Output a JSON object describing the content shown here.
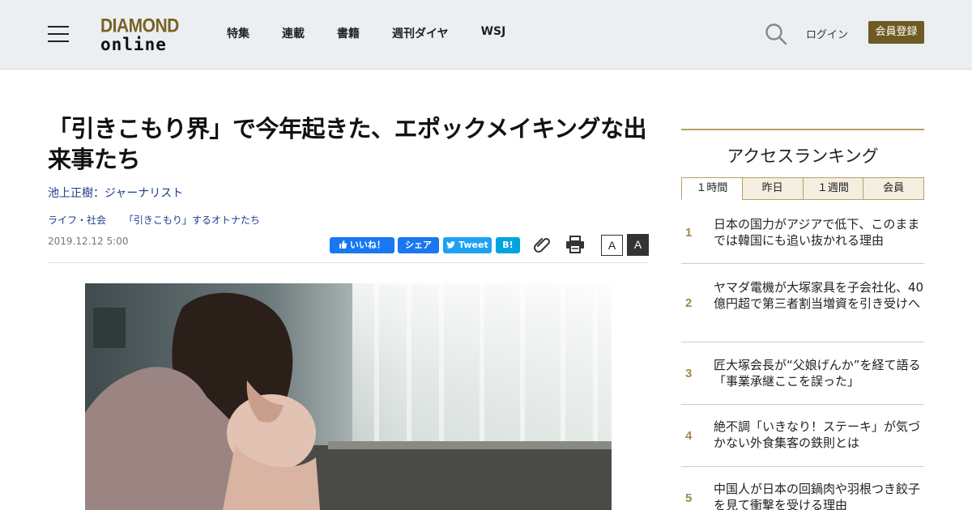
{
  "header": {
    "logo_top": "DIAMOND",
    "logo_bottom": "online",
    "nav": [
      "特集",
      "連載",
      "書籍",
      "週刊ダイヤ",
      "WSJ"
    ],
    "login": "ログイン",
    "register": "会員登録"
  },
  "article": {
    "title": "「引きこもり界」で今年起きた、エポックメイキングな出来事たち",
    "author": "池上正樹：ジャーナリスト",
    "tags": [
      "ライフ・社会",
      "「引きこもり」するオトナたち"
    ],
    "date": "2019.12.12 5:00",
    "share": {
      "like": "いいね！",
      "share": "シェア",
      "tweet": "Tweet",
      "hatena": "B!"
    },
    "font_small": "A",
    "font_large": "A"
  },
  "sidebar": {
    "title": "アクセスランキング",
    "tabs": [
      "１時間",
      "昨日",
      "１週間",
      "会員"
    ],
    "ranking": [
      {
        "rank": "1",
        "text": "日本の国力がアジアで低下、このままでは韓国にも追い抜かれる理由"
      },
      {
        "rank": "2",
        "text": "ヤマダ電機が大塚家具を子会社化、40億円超で第三者割当増資を引き受けへ"
      },
      {
        "rank": "3",
        "text": "匠大塚会長が“父娘げんか”を経て語る「事業承継ここを誤った」"
      },
      {
        "rank": "4",
        "text": "絶不調「いきなり！ステーキ」が気づかない外食集客の鉄則とは"
      },
      {
        "rank": "5",
        "text": "中国人が日本の回鍋肉や羽根つき餃子を見て衝撃を受ける理由"
      }
    ]
  },
  "colors": {
    "brand_gold": "#6e5a23",
    "link_blue": "#1c3c8c",
    "facebook": "#1877f2",
    "twitter": "#1da1f2",
    "hatena": "#00a4de"
  }
}
